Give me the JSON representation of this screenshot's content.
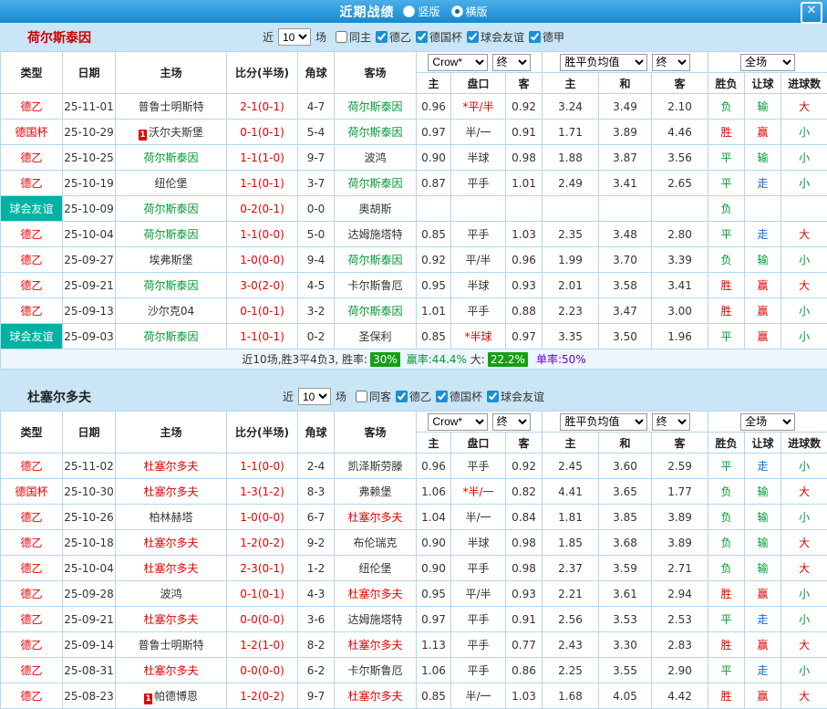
{
  "topbar": {
    "title": "近期战绩",
    "vertical": "竖版",
    "horizontal": "横版",
    "selected": "横版",
    "close": "✕"
  },
  "filters": {
    "near": "近",
    "games": "场"
  },
  "header": {
    "type": "类型",
    "date": "日期",
    "home": "主场",
    "score": "比分(半场)",
    "corner": "角球",
    "away": "客场",
    "crow": "Crow*",
    "final": "终",
    "avg": "胜平负均值",
    "final2": "终",
    "full": "全场",
    "odds_home": "主",
    "odds_hc": "盘口",
    "odds_away": "客",
    "avg_home": "主",
    "avg_draw": "和",
    "avg_away": "客",
    "res": "胜负",
    "let": "让球",
    "goals": "进球数"
  },
  "colors": {
    "highlight_green": "#009933",
    "highlight_red": "#e60000",
    "teal": "#00b2a2",
    "topbar_blue": "#1689d0",
    "badge_green": "#14a014",
    "purple": "#6600cc"
  },
  "section1": {
    "team": "荷尔斯泰因",
    "team_color": "#cc0000",
    "highlight": "#009933",
    "count": "10",
    "checkboxes": [
      {
        "label": "同主",
        "checked": false
      },
      {
        "label": "德乙",
        "checked": true
      },
      {
        "label": "德国杯",
        "checked": true
      },
      {
        "label": "球会友谊",
        "checked": true
      },
      {
        "label": "德甲",
        "checked": true
      }
    ],
    "rows": [
      {
        "league": "德乙",
        "date": "25-11-01",
        "home": "普鲁士明斯特",
        "home_hl": false,
        "home_badge": false,
        "score": "2-1(0-1)",
        "corners": "4-7",
        "away": "荷尔斯泰因",
        "away_hl": true,
        "odds": [
          "0.96",
          "*平/半",
          "0.92"
        ],
        "hc_red": true,
        "avg": [
          "3.24",
          "3.49",
          "2.10"
        ],
        "result": "负",
        "handicap_result": "输",
        "goals": "大"
      },
      {
        "league": "德国杯",
        "date": "25-10-29",
        "home": "沃尔夫斯堡",
        "home_hl": false,
        "home_badge": true,
        "score": "0-1(0-1)",
        "corners": "5-4",
        "away": "荷尔斯泰因",
        "away_hl": true,
        "odds": [
          "0.97",
          "半/一",
          "0.91"
        ],
        "hc_red": false,
        "avg": [
          "1.71",
          "3.89",
          "4.46"
        ],
        "result": "胜",
        "handicap_result": "赢",
        "goals": "小"
      },
      {
        "league": "德乙",
        "date": "25-10-25",
        "home": "荷尔斯泰因",
        "home_hl": true,
        "home_badge": false,
        "score": "1-1(1-0)",
        "corners": "9-7",
        "away": "波鸿",
        "away_hl": false,
        "odds": [
          "0.90",
          "半球",
          "0.98"
        ],
        "hc_red": false,
        "avg": [
          "1.88",
          "3.87",
          "3.56"
        ],
        "result": "平",
        "handicap_result": "输",
        "goals": "小"
      },
      {
        "league": "德乙",
        "date": "25-10-19",
        "home": "纽伦堡",
        "home_hl": false,
        "home_badge": false,
        "score": "1-1(0-1)",
        "corners": "3-7",
        "away": "荷尔斯泰因",
        "away_hl": true,
        "odds": [
          "0.87",
          "平手",
          "1.01"
        ],
        "hc_red": false,
        "avg": [
          "2.49",
          "3.41",
          "2.65"
        ],
        "result": "平",
        "handicap_result": "走",
        "goals": "小"
      },
      {
        "league": "球会友谊",
        "date": "25-10-09",
        "home": "荷尔斯泰因",
        "home_hl": true,
        "home_badge": false,
        "score": "0-2(0-1)",
        "corners": "0-0",
        "away": "奥胡斯",
        "away_hl": false,
        "odds": [
          "",
          "",
          ""
        ],
        "hc_red": false,
        "avg": [
          "",
          "",
          ""
        ],
        "result": "负",
        "handicap_result": "",
        "goals": ""
      },
      {
        "league": "德乙",
        "date": "25-10-04",
        "home": "荷尔斯泰因",
        "home_hl": true,
        "home_badge": false,
        "score": "1-1(0-0)",
        "corners": "5-0",
        "away": "达姆施塔特",
        "away_hl": false,
        "odds": [
          "0.85",
          "平手",
          "1.03"
        ],
        "hc_red": false,
        "avg": [
          "2.35",
          "3.48",
          "2.80"
        ],
        "result": "平",
        "handicap_result": "走",
        "goals": "大"
      },
      {
        "league": "德乙",
        "date": "25-09-27",
        "home": "埃弗斯堡",
        "home_hl": false,
        "home_badge": false,
        "score": "1-0(0-0)",
        "corners": "9-4",
        "away": "荷尔斯泰因",
        "away_hl": true,
        "odds": [
          "0.92",
          "平/半",
          "0.96"
        ],
        "hc_red": false,
        "avg": [
          "1.99",
          "3.70",
          "3.39"
        ],
        "result": "负",
        "handicap_result": "输",
        "goals": "小"
      },
      {
        "league": "德乙",
        "date": "25-09-21",
        "home": "荷尔斯泰因",
        "home_hl": true,
        "home_badge": false,
        "score": "3-0(2-0)",
        "corners": "4-5",
        "away": "卡尔斯鲁厄",
        "away_hl": false,
        "odds": [
          "0.95",
          "半球",
          "0.93"
        ],
        "hc_red": false,
        "avg": [
          "2.01",
          "3.58",
          "3.41"
        ],
        "result": "胜",
        "handicap_result": "赢",
        "goals": "大"
      },
      {
        "league": "德乙",
        "date": "25-09-13",
        "home": "沙尔克04",
        "home_hl": false,
        "home_badge": false,
        "score": "0-1(0-1)",
        "corners": "3-2",
        "away": "荷尔斯泰因",
        "away_hl": true,
        "odds": [
          "1.01",
          "平手",
          "0.88"
        ],
        "hc_red": false,
        "avg": [
          "2.23",
          "3.47",
          "3.00"
        ],
        "result": "胜",
        "handicap_result": "赢",
        "goals": "小"
      },
      {
        "league": "球会友谊",
        "date": "25-09-03",
        "home": "荷尔斯泰因",
        "home_hl": true,
        "home_badge": false,
        "score": "1-1(0-1)",
        "corners": "0-2",
        "away": "圣保利",
        "away_hl": false,
        "odds": [
          "0.85",
          "*半球",
          "0.97"
        ],
        "hc_red": true,
        "avg": [
          "3.35",
          "3.50",
          "1.96"
        ],
        "result": "平",
        "handicap_result": "赢",
        "goals": "小"
      }
    ],
    "summary": {
      "prefix": "近10场,胜3平4负3, 胜率:",
      "win_rate": "30%",
      "profit": "赢率:44.4%",
      "big_label": "大:",
      "big_rate": "22.2%",
      "single": "单率:50%"
    }
  },
  "section2": {
    "team": "杜塞尔多夫",
    "team_color": "#222222",
    "highlight": "#e60000",
    "count": "10",
    "checkboxes": [
      {
        "label": "同客",
        "checked": false
      },
      {
        "label": "德乙",
        "checked": true
      },
      {
        "label": "德国杯",
        "checked": true
      },
      {
        "label": "球会友谊",
        "checked": true
      }
    ],
    "rows": [
      {
        "league": "德乙",
        "date": "25-11-02",
        "home": "杜塞尔多夫",
        "home_hl": true,
        "home_badge": false,
        "score": "1-1(0-0)",
        "corners": "2-4",
        "away": "凯泽斯劳滕",
        "away_hl": false,
        "odds": [
          "0.96",
          "平手",
          "0.92"
        ],
        "hc_red": false,
        "avg": [
          "2.45",
          "3.60",
          "2.59"
        ],
        "result": "平",
        "handicap_result": "走",
        "goals": "小"
      },
      {
        "league": "德国杯",
        "date": "25-10-30",
        "home": "杜塞尔多夫",
        "home_hl": true,
        "home_badge": false,
        "score": "1-3(1-2)",
        "corners": "8-3",
        "away": "弗赖堡",
        "away_hl": false,
        "odds": [
          "1.06",
          "*半/一",
          "0.82"
        ],
        "hc_red": true,
        "avg": [
          "4.41",
          "3.65",
          "1.77"
        ],
        "result": "负",
        "handicap_result": "输",
        "goals": "大"
      },
      {
        "league": "德乙",
        "date": "25-10-26",
        "home": "柏林赫塔",
        "home_hl": false,
        "home_badge": false,
        "score": "1-0(0-0)",
        "corners": "6-7",
        "away": "杜塞尔多夫",
        "away_hl": true,
        "odds": [
          "1.04",
          "半/一",
          "0.84"
        ],
        "hc_red": false,
        "avg": [
          "1.81",
          "3.85",
          "3.89"
        ],
        "result": "负",
        "handicap_result": "输",
        "goals": "小"
      },
      {
        "league": "德乙",
        "date": "25-10-18",
        "home": "杜塞尔多夫",
        "home_hl": true,
        "home_badge": false,
        "score": "1-2(0-2)",
        "corners": "9-2",
        "away": "布伦瑞克",
        "away_hl": false,
        "odds": [
          "0.90",
          "半球",
          "0.98"
        ],
        "hc_red": false,
        "avg": [
          "1.85",
          "3.68",
          "3.89"
        ],
        "result": "负",
        "handicap_result": "输",
        "goals": "大"
      },
      {
        "league": "德乙",
        "date": "25-10-04",
        "home": "杜塞尔多夫",
        "home_hl": true,
        "home_badge": false,
        "score": "2-3(0-1)",
        "corners": "1-2",
        "away": "纽伦堡",
        "away_hl": false,
        "odds": [
          "0.90",
          "平手",
          "0.98"
        ],
        "hc_red": false,
        "avg": [
          "2.37",
          "3.59",
          "2.71"
        ],
        "result": "负",
        "handicap_result": "输",
        "goals": "大"
      },
      {
        "league": "德乙",
        "date": "25-09-28",
        "home": "波鸿",
        "home_hl": false,
        "home_badge": false,
        "score": "0-1(0-1)",
        "corners": "4-3",
        "away": "杜塞尔多夫",
        "away_hl": true,
        "odds": [
          "0.95",
          "平/半",
          "0.93"
        ],
        "hc_red": false,
        "avg": [
          "2.21",
          "3.61",
          "2.94"
        ],
        "result": "胜",
        "handicap_result": "赢",
        "goals": "小"
      },
      {
        "league": "德乙",
        "date": "25-09-21",
        "home": "杜塞尔多夫",
        "home_hl": true,
        "home_badge": false,
        "score": "0-0(0-0)",
        "corners": "3-6",
        "away": "达姆施塔特",
        "away_hl": false,
        "odds": [
          "0.97",
          "平手",
          "0.91"
        ],
        "hc_red": false,
        "avg": [
          "2.56",
          "3.53",
          "2.53"
        ],
        "result": "平",
        "handicap_result": "走",
        "goals": "小"
      },
      {
        "league": "德乙",
        "date": "25-09-14",
        "home": "普鲁士明斯特",
        "home_hl": false,
        "home_badge": false,
        "score": "1-2(1-0)",
        "corners": "8-2",
        "away": "杜塞尔多夫",
        "away_hl": true,
        "odds": [
          "1.13",
          "平手",
          "0.77"
        ],
        "hc_red": false,
        "avg": [
          "2.43",
          "3.30",
          "2.83"
        ],
        "result": "胜",
        "handicap_result": "赢",
        "goals": "大"
      },
      {
        "league": "德乙",
        "date": "25-08-31",
        "home": "杜塞尔多夫",
        "home_hl": true,
        "home_badge": false,
        "score": "0-0(0-0)",
        "corners": "6-2",
        "away": "卡尔斯鲁厄",
        "away_hl": false,
        "odds": [
          "1.06",
          "平手",
          "0.86"
        ],
        "hc_red": false,
        "avg": [
          "2.25",
          "3.55",
          "2.90"
        ],
        "result": "平",
        "handicap_result": "走",
        "goals": "小"
      },
      {
        "league": "德乙",
        "date": "25-08-23",
        "home": "帕德博恩",
        "home_hl": false,
        "home_badge": true,
        "score": "1-2(0-2)",
        "corners": "9-7",
        "away": "杜塞尔多夫",
        "away_hl": true,
        "odds": [
          "0.85",
          "半/一",
          "1.03"
        ],
        "hc_red": false,
        "avg": [
          "1.68",
          "4.05",
          "4.42"
        ],
        "result": "胜",
        "handicap_result": "赢",
        "goals": "大"
      }
    ]
  }
}
